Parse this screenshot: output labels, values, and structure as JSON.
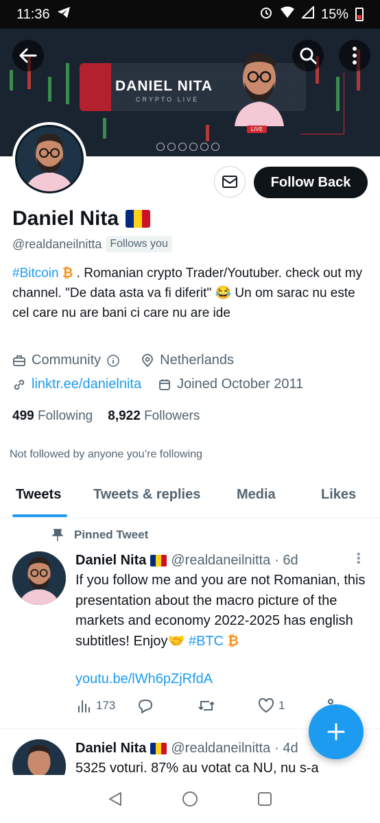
{
  "status_bar": {
    "time": "11:36",
    "battery": "15%"
  },
  "banner": {
    "title": "DANIEL NITA",
    "subtitle": "CRYPTO LIVE",
    "live": "LIVE"
  },
  "header": {
    "follow_button": "Follow Back"
  },
  "profile": {
    "name": "Daniel Nita",
    "handle": "@realdaneilnitta",
    "follows_you": "Follows you",
    "bio_hashtag": "#Bitcoin",
    "bio_rest": ". Romanian crypto Trader/Youtuber. check out my channel. \"De data asta va fi diferit\" 😂 Un om sarac nu este cel care nu are bani ci care nu are ide",
    "category": "Community",
    "location": "Netherlands",
    "website": "linktr.ee/danielnita",
    "joined": "Joined October 2011",
    "following_count": "499",
    "following_label": "Following",
    "followers_count": "8,922",
    "followers_label": "Followers",
    "not_followed": "Not followed by anyone you’re following"
  },
  "tabs": [
    "Tweets",
    "Tweets & replies",
    "Media",
    "Likes"
  ],
  "pinned_label": "Pinned Tweet",
  "tweets": [
    {
      "name": "Daniel Nita",
      "handle": "@realdaneilnitta",
      "time": "· 6d",
      "text": "If you follow me and you are not Romanian, this presentation about the macro picture of the markets  and economy 2022-2025 has english subtitles! Enjoy🤝",
      "hashtag": "#BTC",
      "link": "youtu.be/lWh6pZjRfdA",
      "views": "173",
      "likes": "1"
    },
    {
      "name": "Daniel Nita",
      "handle": "@realdaneilnitta",
      "time": "· 4d",
      "text": "5325 voturi. 87% au votat ca NU, nu s-a"
    }
  ],
  "colors": {
    "accent": "#1d9bf0",
    "text": "#0f1419",
    "muted": "#536471",
    "bitcoin": "#f7931a"
  }
}
